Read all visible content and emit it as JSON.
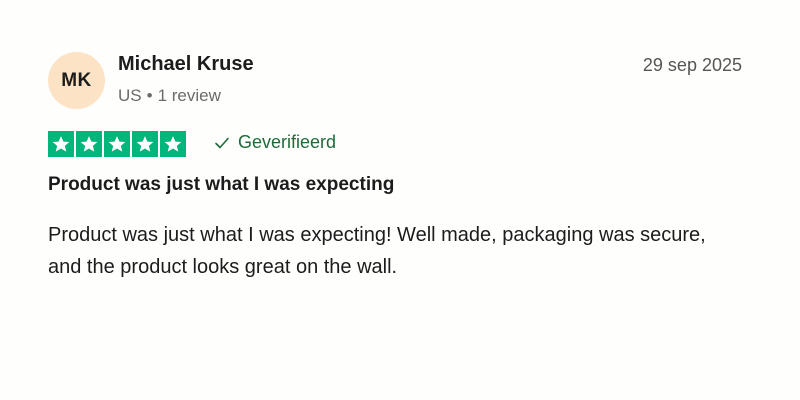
{
  "review": {
    "avatar_initials": "MK",
    "reviewer_name": "Michael Kruse",
    "country": "US",
    "separator": "•",
    "review_count": "1 review",
    "date": "29 sep 2025",
    "rating": 5,
    "rating_max": 5,
    "verified_label": "Geverifieerd",
    "title": "Product was just what I was expecting",
    "body": "Product was just what I was expecting! Well made, packaging was secure, and the product looks great on the wall."
  },
  "colors": {
    "star_background": "#00b67a",
    "avatar_background": "#fde3c5",
    "verified_text": "#1e6b3a"
  },
  "icons": {
    "star": "star-icon",
    "verified": "checkmark-icon"
  }
}
